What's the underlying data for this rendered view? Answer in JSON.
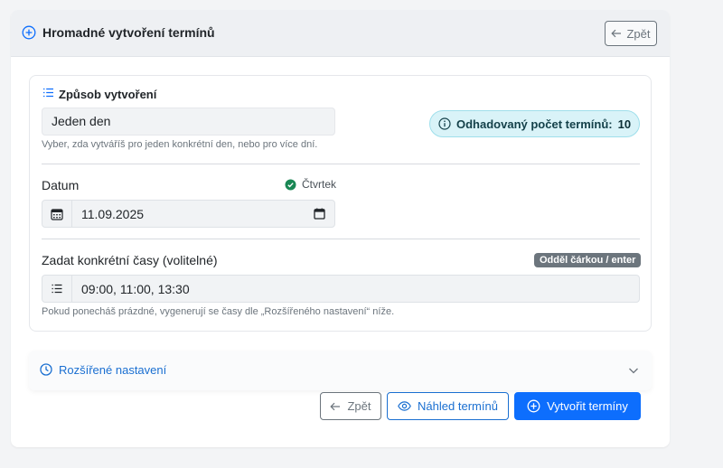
{
  "header": {
    "title": "Hromadné vytvoření termínů",
    "back_label": "Zpět"
  },
  "method": {
    "title": "Způsob vytvoření",
    "selected": "Jeden den",
    "help": "Vyber, zda vytváříš pro jeden konkrétní den, nebo pro více dní."
  },
  "estimate": {
    "label": "Odhadovaný počet termínů:",
    "value": "10"
  },
  "date": {
    "label": "Datum",
    "day_name": "Čtvrtek",
    "value": "11.09.2025"
  },
  "times": {
    "label": "Zadat konkrétní časy (volitelné)",
    "badge": "Odděl čárkou / enter",
    "value": "09:00, 11:00, 13:30",
    "help": "Pokud ponecháš prázdné, vygenerují se časy dle „Rozšířeného nastavení“ níže."
  },
  "advanced": {
    "label": "Rozšířené nastavení"
  },
  "actions": {
    "back_label": "Zpět",
    "preview_label": "Náhled termínů",
    "create_label": "Vytvořit termíny"
  },
  "colors": {
    "primary": "#0d6efd",
    "info_bg": "#d9f3f8",
    "success": "#198754",
    "secondary": "#6c757d"
  },
  "icons": {
    "header": "plus-circle-icon",
    "method": "list-icon",
    "estimate": "info-circle-icon",
    "day_ok": "check-circle-icon",
    "calendar": "calendar-icon",
    "times": "list-icon",
    "advanced": "clock-icon",
    "chevron": "chevron-down-icon",
    "preview": "eye-icon",
    "create": "plus-circle-icon",
    "back": "arrow-left-icon"
  }
}
